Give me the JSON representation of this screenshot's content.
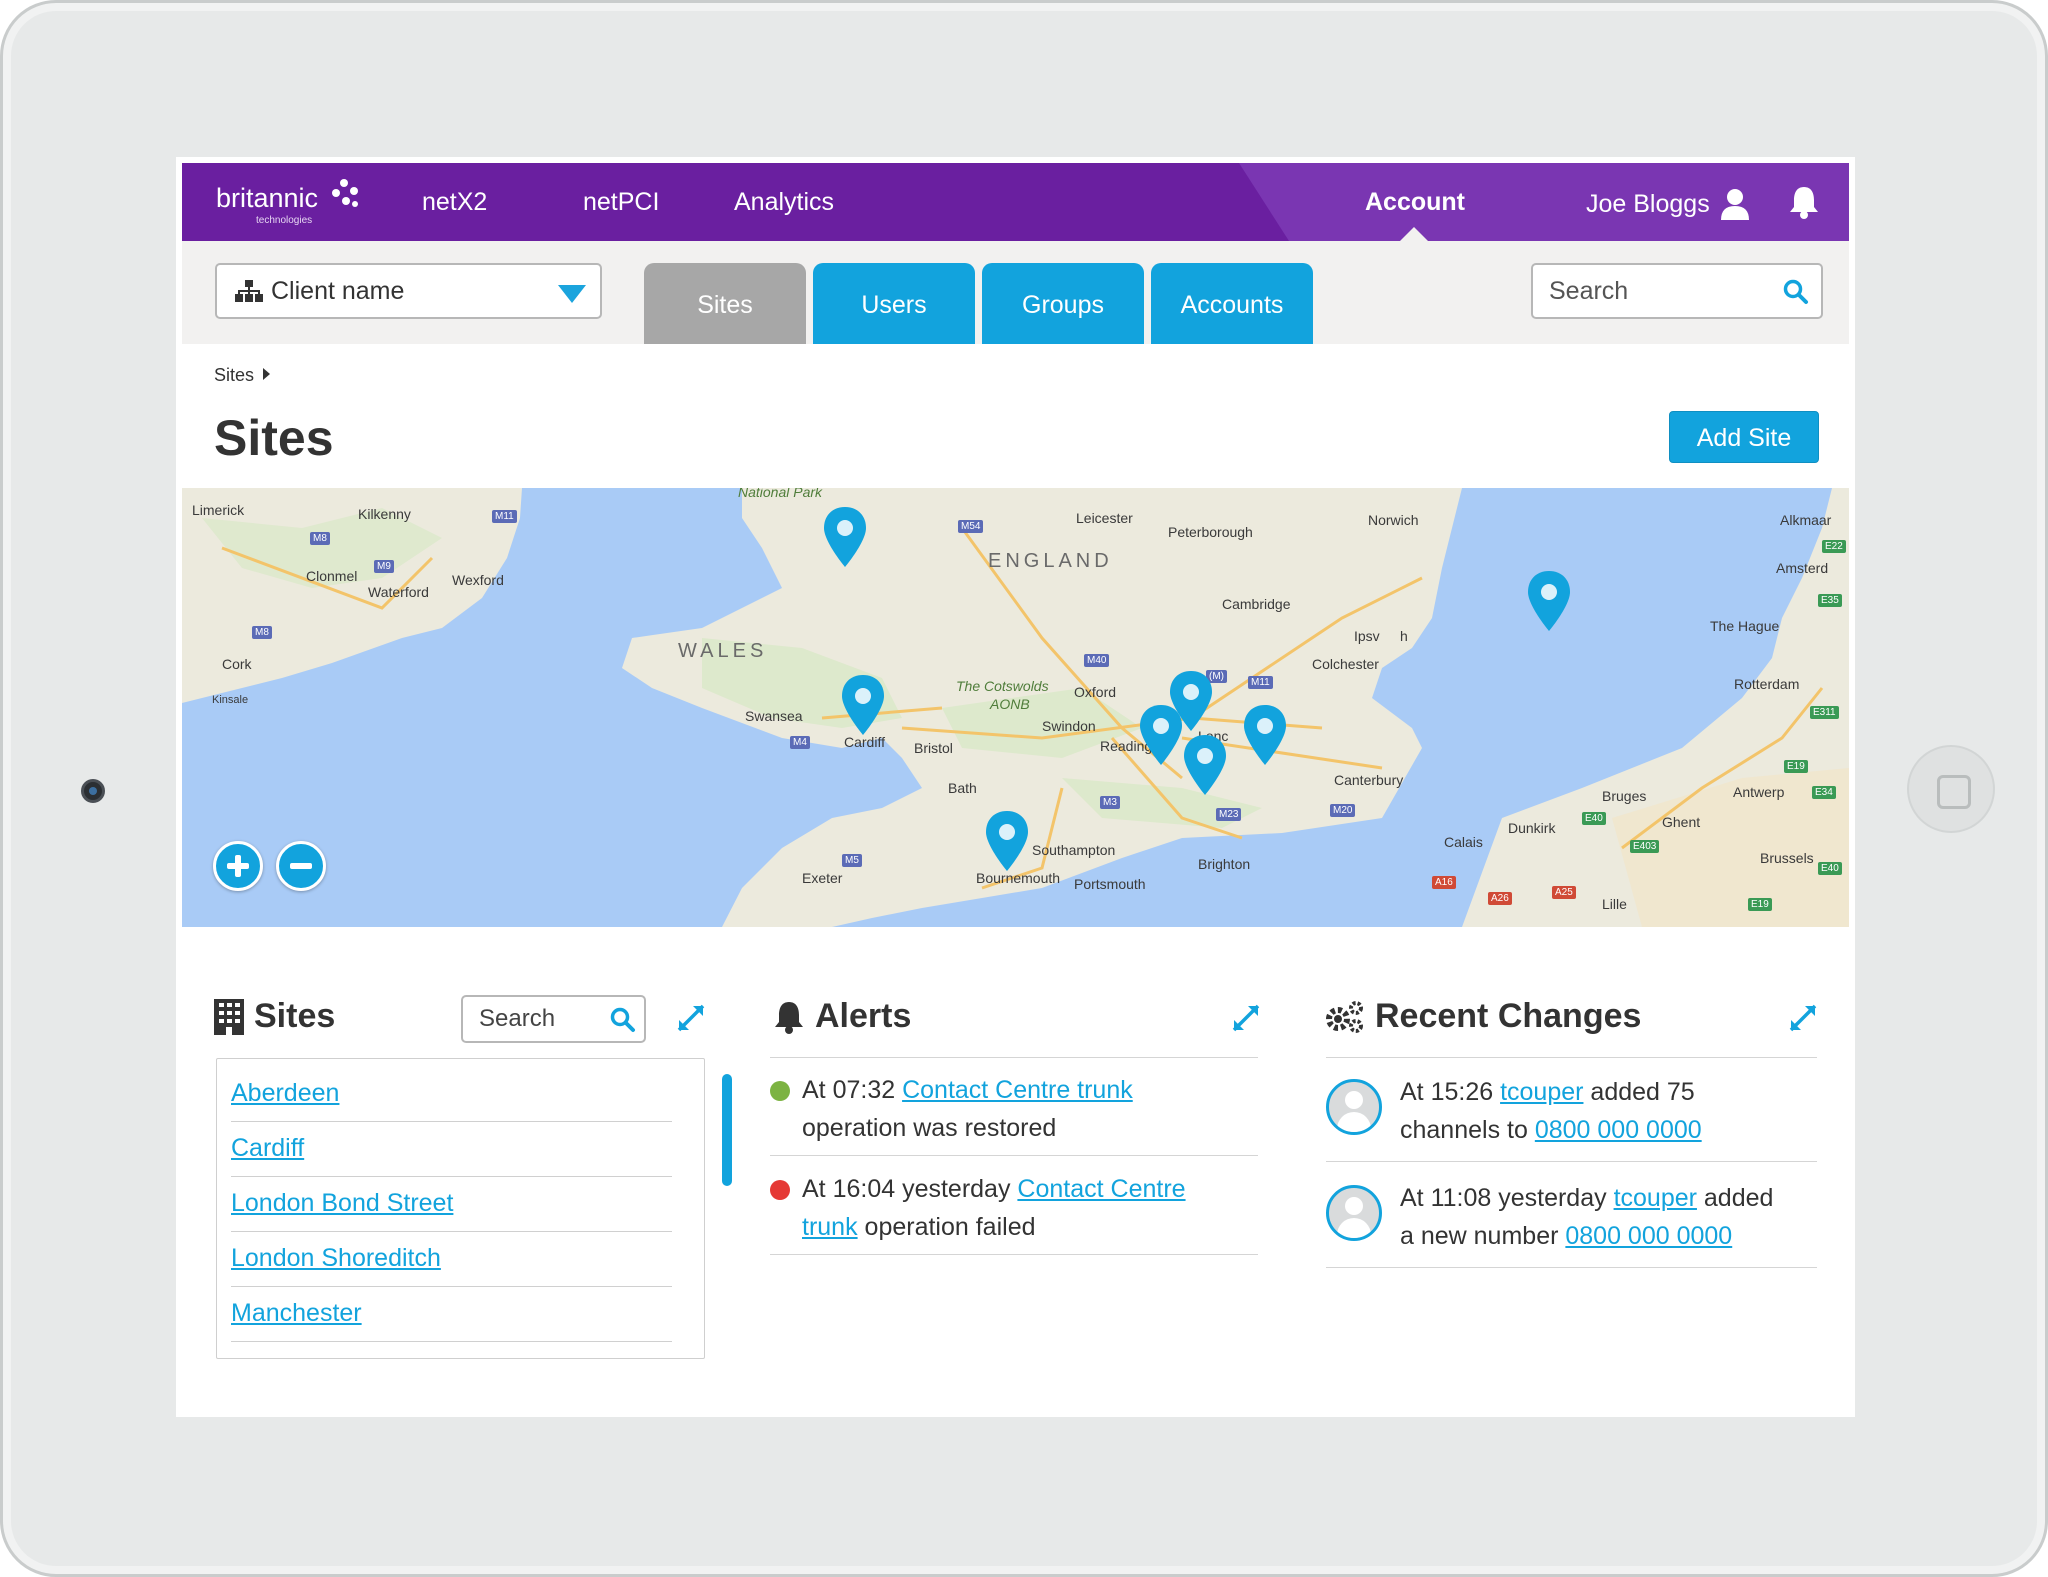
{
  "brand": {
    "name": "britannic",
    "subtitle": "technologies"
  },
  "nav": {
    "items": [
      {
        "label": "netX2"
      },
      {
        "label": "netPCI"
      },
      {
        "label": "Analytics"
      }
    ],
    "account": "Account",
    "user": "Joe Bloggs"
  },
  "subbar": {
    "client_select": "Client name",
    "tabs": [
      {
        "label": "Sites",
        "active": true
      },
      {
        "label": "Users",
        "active": false
      },
      {
        "label": "Groups",
        "active": false
      },
      {
        "label": "Accounts",
        "active": false
      }
    ],
    "search_placeholder": "Search"
  },
  "breadcrumb": "Sites",
  "page_title": "Sites",
  "add_site_button": "Add Site",
  "map": {
    "labels": {
      "limerick": "Limerick",
      "kilkenny": "Kilkenny",
      "clonmel": "Clonmel",
      "waterford": "Waterford",
      "wexford": "Wexford",
      "cork": "Cork",
      "kinsale": "Kinsale",
      "wales": "WALES",
      "england": "ENGLAND",
      "national_park": "National Park",
      "leicester": "Leicester",
      "peterborough": "Peterborough",
      "norwich": "Norwich",
      "cambridge": "Cambridge",
      "colchester": "Colchester",
      "ipswich_a": "Ipsv",
      "ipswich_b": "h",
      "swansea": "Swansea",
      "cardiff": "Cardiff",
      "bristol": "Bristol",
      "bath": "Bath",
      "swindon": "Swindon",
      "oxford": "Oxford",
      "cotswolds": "The Cotswolds",
      "aonb": "AONB",
      "reading": "Reading",
      "london": "Lonc",
      "canterbury": "Canterbury",
      "southampton": "Southampton",
      "bournemouth": "Bournemouth",
      "portsmouth": "Portsmouth",
      "brighton": "Brighton",
      "exeter": "Exeter",
      "calais": "Calais",
      "dunkirk": "Dunkirk",
      "bruges": "Bruges",
      "ghent": "Ghent",
      "brussels": "Brussels",
      "lille": "Lille",
      "antwerp": "Antwerp",
      "rotterdam": "Rotterdam",
      "the_hague": "The Hague",
      "amsterdam": "Amsterd",
      "alkmaar": "Alkmaar"
    },
    "roads": {
      "m8": "M8",
      "m9": "M9",
      "m11": "M11",
      "m8b": "M8",
      "m54": "M54",
      "m40": "M40",
      "m11b": "M11",
      "m4": "M4",
      "m3": "M3",
      "m23": "M23",
      "m20": "M20",
      "m5": "M5",
      "am": "(M)",
      "a16": "A16",
      "a26": "A26",
      "a25": "A25",
      "e40": "E40",
      "e403": "E403",
      "e19": "E19",
      "e34": "E34",
      "e311": "E311",
      "e19b": "E19",
      "e35": "E35",
      "e22": "E22",
      "e40b": "E40",
      "e19c": "E19"
    },
    "site_pins": 8
  },
  "sites_panel": {
    "title": "Sites",
    "search_placeholder": "Search",
    "items": [
      "Aberdeen",
      "Cardiff",
      "London Bond Street",
      "London Shoreditch",
      "Manchester"
    ]
  },
  "alerts_panel": {
    "title": "Alerts",
    "items": [
      {
        "status": "ok",
        "prefix": "At 07:32 ",
        "link": "Contact Centre trunk",
        "suffix": "operation was restored"
      },
      {
        "status": "error",
        "prefix": "At 16:04 yesterday ",
        "link_a": "Contact Centre",
        "link_b": "trunk",
        "suffix": " operation failed"
      }
    ]
  },
  "changes_panel": {
    "title": "Recent Changes",
    "items": [
      {
        "prefix": "At 15:26 ",
        "user": "tcouper",
        "mid": " added 75",
        "line2": "channels to ",
        "number": "0800 000 0000"
      },
      {
        "prefix": "At 11:08 yesterday ",
        "user": "tcouper",
        "mid": " added",
        "line2": "a new number ",
        "number": "0800 000 0000"
      }
    ]
  },
  "colors": {
    "brand_purple": "#6a1fa0",
    "accent_blue": "#12a3dd",
    "ok_green": "#7cb342",
    "error_red": "#e53935"
  }
}
